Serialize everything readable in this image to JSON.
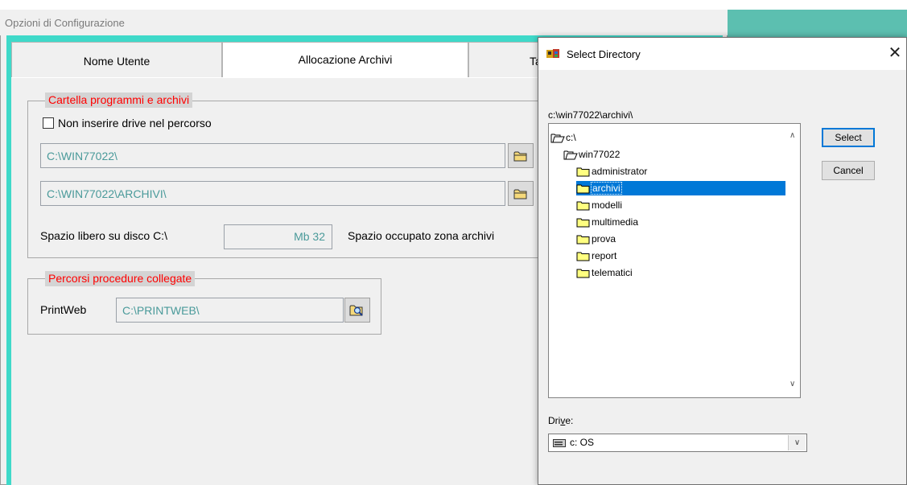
{
  "window": {
    "title": "Opzioni di Configurazione",
    "tabs": [
      {
        "label": "Nome Utente"
      },
      {
        "label": "Allocazione Archivi"
      },
      {
        "label": "Ta"
      }
    ]
  },
  "archives_group": {
    "legend": "Cartella programmi e archivi",
    "checkbox_label": "Non inserire drive nel percorso",
    "checkbox_checked": false,
    "programs_path": "C:\\WIN77022\\",
    "archives_path": "C:\\WIN77022\\ARCHIVI\\",
    "free_space_label": "Spazio libero su disco C:\\",
    "free_space_value": "Mb  32",
    "occupied_label": "Spazio occupato zona archivi"
  },
  "linked_group": {
    "legend": "Percorsi procedure collegate",
    "printweb_label": "PrintWeb",
    "printweb_path": "C:\\PRINTWEB\\"
  },
  "dialog": {
    "title": "Select Directory",
    "current_path": "c:\\win77022\\archivi\\",
    "tree": [
      {
        "label": "c:\\",
        "level": 0,
        "icon": "open-folder-icon",
        "selected": false
      },
      {
        "label": "win77022",
        "level": 1,
        "icon": "open-folder-icon",
        "selected": false
      },
      {
        "label": "administrator",
        "level": 2,
        "icon": "folder-icon",
        "selected": false
      },
      {
        "label": "archivi",
        "level": 2,
        "icon": "folder-icon",
        "selected": true
      },
      {
        "label": "modelli",
        "level": 2,
        "icon": "folder-icon",
        "selected": false
      },
      {
        "label": "multimedia",
        "level": 2,
        "icon": "folder-icon",
        "selected": false
      },
      {
        "label": "prova",
        "level": 2,
        "icon": "folder-icon",
        "selected": false
      },
      {
        "label": "report",
        "level": 2,
        "icon": "folder-icon",
        "selected": false
      },
      {
        "label": "telematici",
        "level": 2,
        "icon": "folder-icon",
        "selected": false
      }
    ],
    "select_button": "Select",
    "cancel_button": "Cancel",
    "drive_label": "Drive:",
    "drive_value": "c: OS"
  },
  "colors": {
    "teal": "#3fd9c9",
    "legend_text": "#ff0000",
    "legend_bg": "#d4d4d4",
    "field_text": "#4a9a9a",
    "selection": "#0078d7"
  }
}
